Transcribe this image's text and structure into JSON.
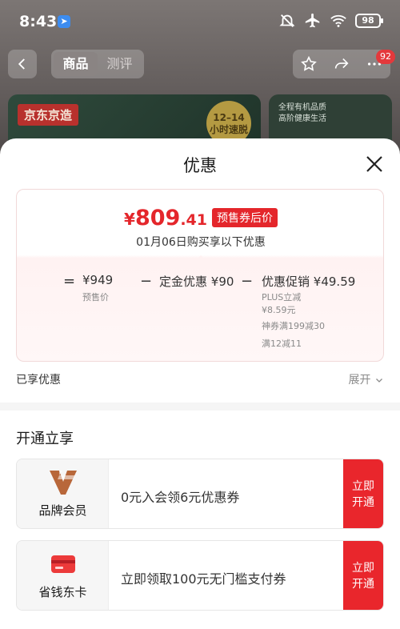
{
  "status": {
    "time": "8:43",
    "battery": "98"
  },
  "nav": {
    "tabs": [
      "商品",
      "测评"
    ],
    "badge_count": "92"
  },
  "banner": {
    "brand": "京东京造",
    "speed_line1": "12–14",
    "speed_line2": "小时速脱",
    "right_line1": "全程有机品质",
    "right_line2": "高阶健康生活"
  },
  "sheet": {
    "title": "优惠",
    "price": {
      "currency": "¥",
      "int": "809",
      "dec": ".41",
      "tag": "预售券后价"
    },
    "subtitle": "01月06日购买享以下优惠",
    "formula": {
      "eq": "=",
      "base_amount": "¥949",
      "base_label": "预售价",
      "minus1": "−",
      "deposit_label": "定金优惠",
      "deposit_amount": "¥90",
      "minus2": "−",
      "promo_label": "优惠促销",
      "promo_amount": "¥49.59",
      "plus_label": "PLUS立减",
      "plus_amount": "¥8.59元",
      "coupon1": "神券满199减30",
      "coupon2": "满12减11"
    },
    "enjoyed_label": "已享优惠",
    "expand_label": "展开",
    "section_title": "开通立享",
    "offers": [
      {
        "name": "品牌会员",
        "text": "0元入会领6元优惠券",
        "button_line1": "立即",
        "button_line2": "开通",
        "icon": "brand-v-icon"
      },
      {
        "name": "省钱东卡",
        "text": "立即领取100元无门槛支付券",
        "button_line1": "立即",
        "button_line2": "开通",
        "icon": "red-card-icon"
      }
    ]
  },
  "colors": {
    "accent": "#e4262b",
    "button": "#e9262c"
  }
}
